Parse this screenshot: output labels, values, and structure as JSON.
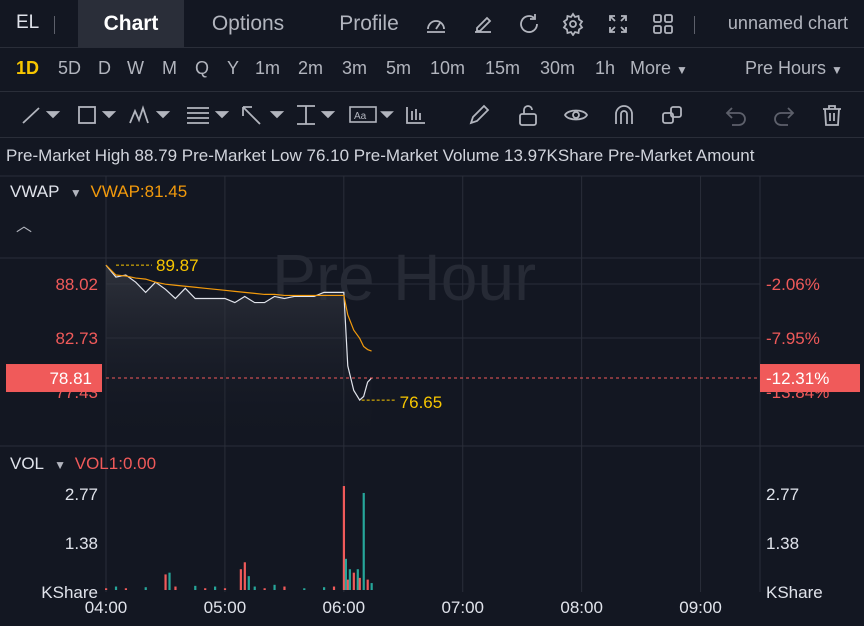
{
  "header": {
    "ticker": "EL",
    "tabs": [
      {
        "label": "Chart",
        "active": true
      },
      {
        "label": "Options",
        "active": false
      },
      {
        "label": "Profile",
        "active": false
      }
    ],
    "icons": [
      "gauge-icon",
      "edit-icon",
      "refresh-icon",
      "settings-icon",
      "fullscreen-icon",
      "grid-icon"
    ],
    "chart_name": "unnamed chart"
  },
  "intervals": {
    "items": [
      "1D",
      "5D",
      "D",
      "W",
      "M",
      "Q",
      "Y",
      "1m",
      "2m",
      "3m",
      "5m",
      "10m",
      "15m",
      "30m",
      "1h"
    ],
    "active": "1D",
    "more_label": "More",
    "session_label": "Pre Hours"
  },
  "toolbar": {
    "tools": [
      "trendline-icon",
      "rectangle-icon",
      "pattern-icon",
      "fib-icon",
      "arrow-icon",
      "text-icon",
      "label-icon",
      "chart-pattern-icon",
      "pencil-icon",
      "lock-icon",
      "eye-icon",
      "magnet-icon",
      "duplicate-icon",
      "undo-icon",
      "redo-icon",
      "trash-icon"
    ]
  },
  "info": {
    "high_label": "Pre-Market High",
    "high_value": "88.79",
    "low_label": "Pre-Market Low",
    "low_value": "76.10",
    "volume_label": "Pre-Market Volume",
    "volume_value": "13.97KShare",
    "amount_label": "Pre-Market Amount"
  },
  "indicators": {
    "vwap_name": "VWAP",
    "vwap_value": "VWAP:81.45",
    "vol_name": "VOL",
    "vol_value": "VOL1:0.00"
  },
  "watermark": "Pre Hour",
  "colors": {
    "background": "#131722",
    "price_line": "#e0e3eb",
    "vwap_line": "#f29a0c",
    "down": "#f05a5a",
    "up": "#26a69a",
    "annotation": "#f7c600",
    "grid": "#2a2e39"
  },
  "price_axis": {
    "left_ticks": [
      "88.02",
      "82.73",
      "77.43"
    ],
    "right_ticks": [
      "-2.06%",
      "-7.95%",
      "-13.84%"
    ],
    "current_price": "78.81",
    "current_pct": "-12.31%",
    "high_marker": "89.87",
    "low_marker": "76.65"
  },
  "volume_axis": {
    "left_ticks": [
      "2.77",
      "1.38"
    ],
    "right_ticks": [
      "2.77",
      "1.38"
    ],
    "unit": "KShare"
  },
  "time_axis": [
    "04:00",
    "05:00",
    "06:00",
    "07:00",
    "08:00",
    "09:00"
  ],
  "chart_data": {
    "type": "line",
    "x": [
      "04:00",
      "04:05",
      "04:10",
      "04:15",
      "04:20",
      "04:25",
      "04:30",
      "04:35",
      "04:40",
      "04:45",
      "04:50",
      "04:55",
      "05:00",
      "05:05",
      "05:10",
      "05:15",
      "05:20",
      "05:25",
      "05:30",
      "05:35",
      "05:40",
      "05:45",
      "05:50",
      "05:55",
      "06:00",
      "06:02",
      "06:05",
      "06:08",
      "06:10",
      "06:12",
      "06:14"
    ],
    "series": [
      {
        "name": "",
        "values": [
          89.87,
          88.7,
          88.9,
          88.2,
          87.2,
          88.2,
          87.5,
          86.6,
          87.6,
          86.6,
          86.6,
          86.6,
          86.6,
          86.2,
          86.8,
          86.2,
          86.2,
          86.8,
          86.6,
          86.8,
          86.8,
          86.8,
          87.2,
          87.2,
          87.2,
          80.0,
          77.6,
          76.65,
          77.0,
          78.4,
          78.81
        ]
      },
      {
        "name": "VWAP",
        "values": [
          89.87,
          88.9,
          88.8,
          88.6,
          88.5,
          88.2,
          88.0,
          87.9,
          87.8,
          87.7,
          87.6,
          87.5,
          87.4,
          87.3,
          87.2,
          87.1,
          87.0,
          87.0,
          86.9,
          86.9,
          86.9,
          86.9,
          86.9,
          86.9,
          86.9,
          85.0,
          83.5,
          82.7,
          81.9,
          81.6,
          81.45
        ]
      }
    ],
    "volume": {
      "unit": "KShare",
      "x": [
        "04:00",
        "04:05",
        "04:10",
        "04:20",
        "04:30",
        "04:32",
        "04:35",
        "04:45",
        "04:50",
        "04:55",
        "05:00",
        "05:08",
        "05:10",
        "05:12",
        "05:15",
        "05:20",
        "05:25",
        "05:30",
        "05:40",
        "05:50",
        "05:55",
        "06:00",
        "06:01",
        "06:02",
        "06:03",
        "06:05",
        "06:07",
        "06:08",
        "06:10",
        "06:12",
        "06:14"
      ],
      "values": [
        0.05,
        0.1,
        0.05,
        0.08,
        0.45,
        0.5,
        0.1,
        0.12,
        0.05,
        0.1,
        0.05,
        0.6,
        0.8,
        0.4,
        0.1,
        0.05,
        0.15,
        0.1,
        0.05,
        0.08,
        0.1,
        3.0,
        0.9,
        0.3,
        0.6,
        0.5,
        0.6,
        0.35,
        2.8,
        0.3,
        0.2
      ],
      "direction": [
        "down",
        "up",
        "down",
        "up",
        "down",
        "up",
        "down",
        "up",
        "down",
        "up",
        "down",
        "down",
        "down",
        "up",
        "up",
        "down",
        "up",
        "down",
        "up",
        "up",
        "down",
        "down",
        "up",
        "down",
        "up",
        "down",
        "up",
        "down",
        "up",
        "down",
        "up"
      ]
    },
    "ylim": [
      75.5,
      91.0
    ],
    "xlim": [
      "04:00",
      "09:30"
    ]
  }
}
